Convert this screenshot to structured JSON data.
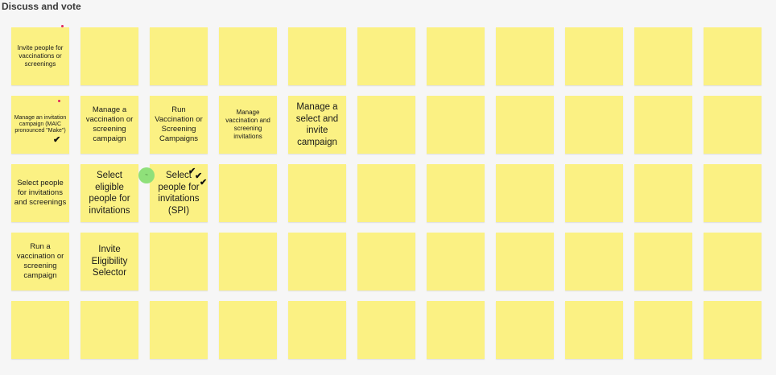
{
  "board": {
    "title": "Discuss and vote",
    "note_color": "#fbf183",
    "vote_mark": "✔",
    "cursor_badge_label": "~"
  },
  "notes": [
    [
      "Invite people for vaccinations or screenings",
      "",
      "",
      "",
      "",
      "",
      "",
      "",
      "",
      "",
      ""
    ],
    [
      "Manage an invitation campaign (MAIC pronounced \"Make\")",
      "Manage a vaccination or screening campaign",
      "Run Vaccination or Screening Campaigns",
      "Manage vaccination and screening invitations",
      "Manage a select and invite campaign",
      "",
      "",
      "",
      "",
      "",
      ""
    ],
    [
      "Select people for invitations and screenings",
      "Select eligible people for invitations",
      "Select people for invitations (SPI)",
      "",
      "",
      "",
      "",
      "",
      "",
      "",
      ""
    ],
    [
      "Run a vaccination or screening campaign",
      "Invite Eligibility Selector",
      "",
      "",
      "",
      "",
      "",
      "",
      "",
      "",
      ""
    ],
    [
      "",
      "",
      "",
      "",
      "",
      "",
      "",
      "",
      "",
      "",
      ""
    ]
  ]
}
